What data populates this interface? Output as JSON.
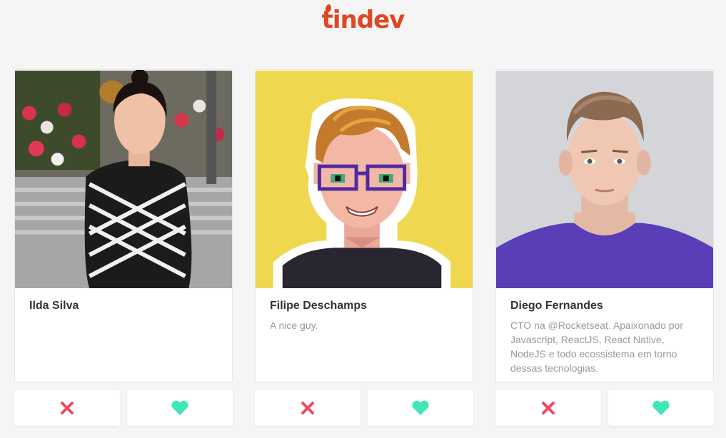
{
  "app": {
    "logo_text": "tindev"
  },
  "developers": [
    {
      "name": "Ilda Silva",
      "bio": ""
    },
    {
      "name": "Filipe Deschamps",
      "bio": "A nice guy."
    },
    {
      "name": "Diego Fernandes",
      "bio": "CTO na @Rocketseat. Apaixonado por Javascript, ReactJS, React Native, NodeJS e todo ecossistema em torno dessas tecnologias."
    }
  ],
  "icons": {
    "dislike": "close-icon",
    "like": "heart-icon"
  },
  "colors": {
    "brand": "#df4723",
    "dislike": "#ee4a62",
    "like": "#3ee6b8",
    "background": "#f5f5f5"
  }
}
